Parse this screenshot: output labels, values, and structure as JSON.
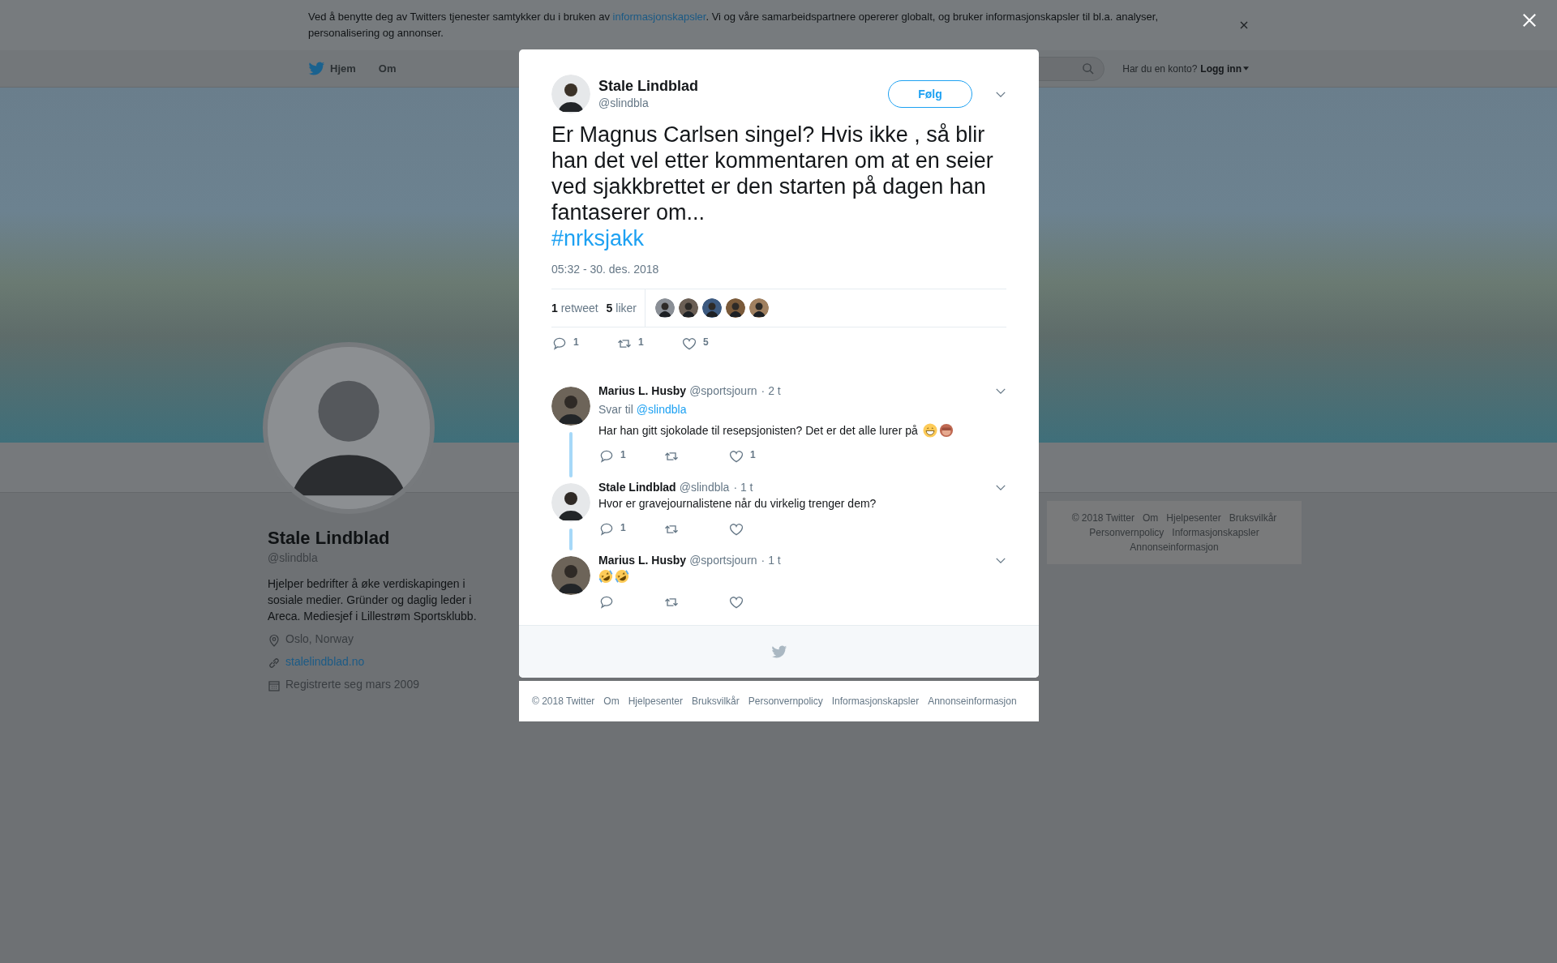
{
  "cookie_banner": {
    "text_before": "Ved å benytte deg av Twitters tjenester samtykker du i bruken av ",
    "link": "informasjonskapsler",
    "text_after": ". Vi og våre samarbeidspartnere opererer globalt, og bruker informasjonskapsler til bl.a. analyser, personalisering og annonser."
  },
  "nav": {
    "items": [
      "Hjem",
      "Om"
    ],
    "account_prompt": "Har du en konto?",
    "login": "Logg inn"
  },
  "profile": {
    "name": "Stale Lindblad",
    "handle": "@slindbla",
    "bio": "Hjelper bedrifter å øke verdiskapingen i sosiale medier. Gründer og daglig leder i Areca. Mediesjef i Lillestrøm Sportsklubb.",
    "details": [
      {
        "kind": "location",
        "text": "Oslo, Norway"
      },
      {
        "kind": "website",
        "text": "stalelindblad.no"
      },
      {
        "kind": "joined",
        "text": "Registrerte seg mars 2009"
      }
    ]
  },
  "side_footer": [
    "© 2018 Twitter",
    "Om",
    "Hjelpesenter",
    "Bruksvilkår",
    "Personvernpolicy",
    "Informasjonskapsler",
    "Annonseinformasjon"
  ],
  "tweet": {
    "name": "Stale Lindblad",
    "handle": "@slindbla",
    "follow": "Følg",
    "text": "Er Magnus Carlsen singel? Hvis ikke , så blir han det vel etter kommentaren om at en seier ved sjakkbrettet er den starten på dagen han fantaserer om...",
    "hashtag": "#nrksjakk",
    "timestamp": "05:32 - 30. des. 2018",
    "stats": [
      {
        "count": "1",
        "label": "retweet"
      },
      {
        "count": "5",
        "label": "liker"
      }
    ],
    "actions": [
      {
        "kind": "reply",
        "count": "1"
      },
      {
        "kind": "retweet",
        "count": "1"
      },
      {
        "kind": "like",
        "count": "5"
      }
    ]
  },
  "replies": [
    {
      "name": "Marius L. Husby",
      "handle": "@sportsjourn",
      "time": "· 2 t",
      "reply_to_label": "Svar til",
      "reply_to": "@slindbla",
      "text": "Har han gitt sjokolade til resepsjonisten? Det er det alle lurer på",
      "emojis": [
        {
          "kind": "grinning"
        },
        {
          "kind": "see_no_evil"
        }
      ],
      "thread": true,
      "actions": [
        {
          "kind": "reply",
          "count": "1"
        },
        {
          "kind": "retweet"
        },
        {
          "kind": "like",
          "count": "1"
        }
      ]
    },
    {
      "name": "Stale Lindblad",
      "handle": "@slindbla",
      "time": "· 1 t",
      "text": "Hvor er gravejournalistene når du virkelig trenger dem?",
      "thread": true,
      "actions": [
        {
          "kind": "reply",
          "count": "1"
        },
        {
          "kind": "retweet"
        },
        {
          "kind": "like"
        }
      ]
    },
    {
      "name": "Marius L. Husby",
      "handle": "@sportsjourn",
      "time": "· 1 t",
      "emojis": [
        {
          "kind": "rofl"
        },
        {
          "kind": "rofl"
        }
      ],
      "thread": false,
      "actions": [
        {
          "kind": "reply"
        },
        {
          "kind": "retweet"
        },
        {
          "kind": "like"
        }
      ]
    }
  ],
  "modal_footer": [
    "© 2018 Twitter",
    "Om",
    "Hjelpesenter",
    "Bruksvilkår",
    "Personvernpolicy",
    "Informasjonskapsler",
    "Annonseinformasjon"
  ]
}
